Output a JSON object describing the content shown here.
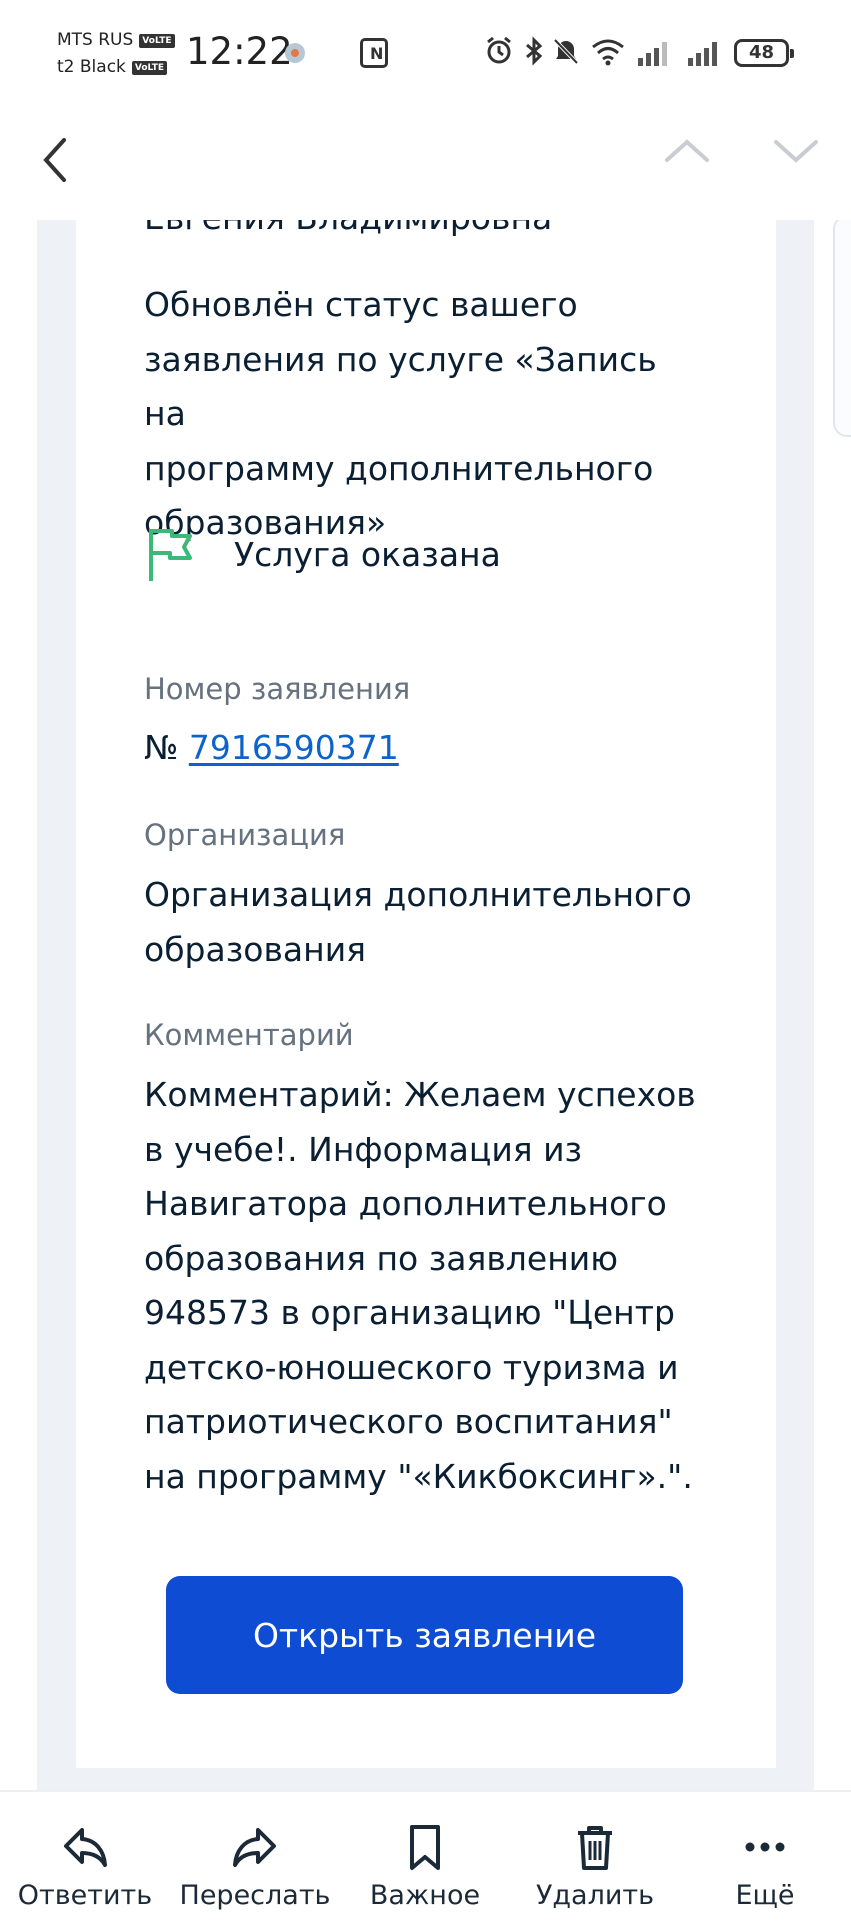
{
  "status_bar": {
    "carrier1": "MTS RUS",
    "carrier2": "t2 Black",
    "volte": "VoLTE",
    "time": "12:22",
    "battery": "48",
    "icons": [
      "nfc-icon",
      "alarm-icon",
      "bluetooth-icon",
      "mute-icon",
      "wifi-icon",
      "signal-icon",
      "signal-icon",
      "battery-icon"
    ]
  },
  "toolbar": {
    "back_icon": "chevron-left-icon",
    "prev_icon": "chevron-up-icon",
    "next_icon": "chevron-down-icon"
  },
  "message": {
    "recipient_name": "Евгения Владимировна",
    "status_update_lines": [
      "Обновлён статус вашего",
      "заявления по услуге «Запись на",
      "программу дополнительного",
      "образования»"
    ],
    "status_icon": "flag-icon",
    "status_text": "Услуга оказана",
    "application_number_label": "Номер заявления",
    "application_number_prefix": "№",
    "application_number": "7916590371",
    "organization_label": "Организация",
    "organization_lines": [
      "Организация дополнительного",
      "образования"
    ],
    "comment_label": "Комментарий",
    "comment_lines": [
      "Комментарий: Желаем успехов",
      "в учебе!. Информация из",
      "Навигатора дополнительного",
      "образования по заявлению",
      "948573 в организацию \"Центр",
      "детско-юношеского туризма и",
      "патриотического воспитания\"",
      "на программу \"«Кикбоксинг».\"."
    ],
    "open_button": "Открыть заявление"
  },
  "bottom_bar": {
    "items": [
      {
        "label": "Ответить",
        "icon": "reply-icon"
      },
      {
        "label": "Переслать",
        "icon": "forward-icon"
      },
      {
        "label": "Важное",
        "icon": "bookmark-icon"
      },
      {
        "label": "Удалить",
        "icon": "trash-icon"
      },
      {
        "label": "Ещё",
        "icon": "more-icon"
      }
    ]
  },
  "colors": {
    "primary_button": "#0d4cd3",
    "link": "#0d63c9",
    "status_flag": "#3cb878",
    "label_gray": "#66727f"
  }
}
